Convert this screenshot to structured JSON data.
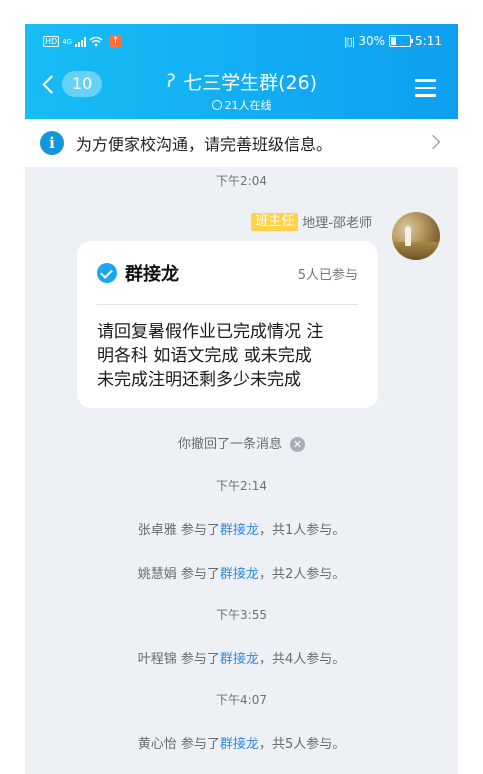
{
  "status_bar": {
    "left_hd": "HD",
    "network": "4G",
    "battery_text": "30%",
    "battery_level": 0.3,
    "time": "5:11"
  },
  "header": {
    "back_count": "10",
    "title": "七三学生群(26)",
    "online": "21人在线"
  },
  "notice": {
    "text": "为方便家校沟通，请完善班级信息。"
  },
  "timestamps": {
    "t1": "下午2:04",
    "t2": "下午2:14",
    "t3": "下午3:55",
    "t4": "下午4:07"
  },
  "sender": {
    "role": "班主任",
    "name": "地理-邵老师"
  },
  "card": {
    "title": "群接龙",
    "participants": "5人已参与",
    "body_lines": [
      "请回复暑假作业已完成情况  注",
      "明各科 如语文完成 或未完成",
      "未完成注明还剩多少未完成"
    ]
  },
  "recall_notice": "你撤回了一条消息",
  "system_messages": [
    {
      "name": "张卓雅",
      "mid": " 参与了",
      "link": "群接龙",
      "tail": "，共1人参与。"
    },
    {
      "name": "姚慧娟",
      "mid": " 参与了",
      "link": "群接龙",
      "tail": "，共2人参与。"
    },
    {
      "name": "叶程锦",
      "mid": " 参与了",
      "link": "群接龙",
      "tail": "，共4人参与。"
    },
    {
      "name": "黄心怡",
      "mid": " 参与了",
      "link": "群接龙",
      "tail": "，共5人参与。"
    }
  ]
}
